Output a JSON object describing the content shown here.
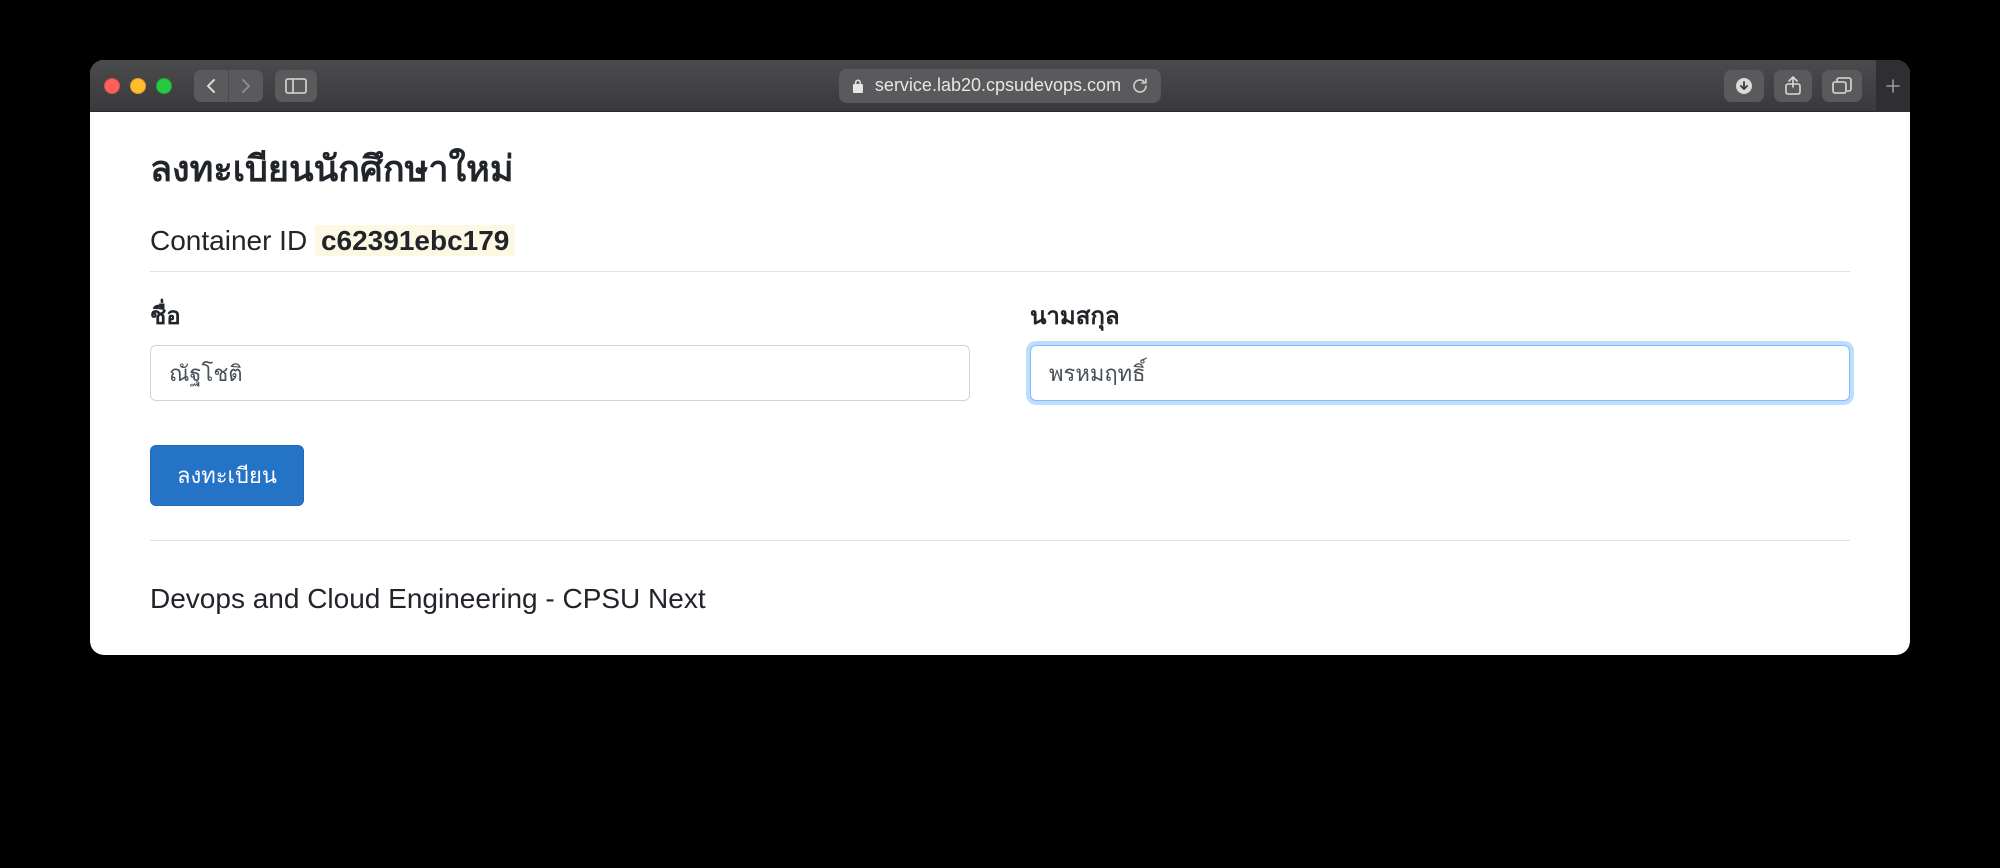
{
  "browser": {
    "url_display": "service.lab20.cpsudevops.com"
  },
  "page": {
    "title": "ลงทะเบียนนักศึกษาใหม่",
    "container_id_label": "Container ID",
    "container_id_value": "c62391ebc179",
    "form": {
      "first_name": {
        "label": "ชื่อ",
        "value": "ณัฐโชติ"
      },
      "last_name": {
        "label": "นามสกุล",
        "value": "พรหมฤทธิ์"
      },
      "submit_label": "ลงทะเบียน"
    },
    "footer": "Devops and Cloud Engineering - CPSU Next"
  }
}
